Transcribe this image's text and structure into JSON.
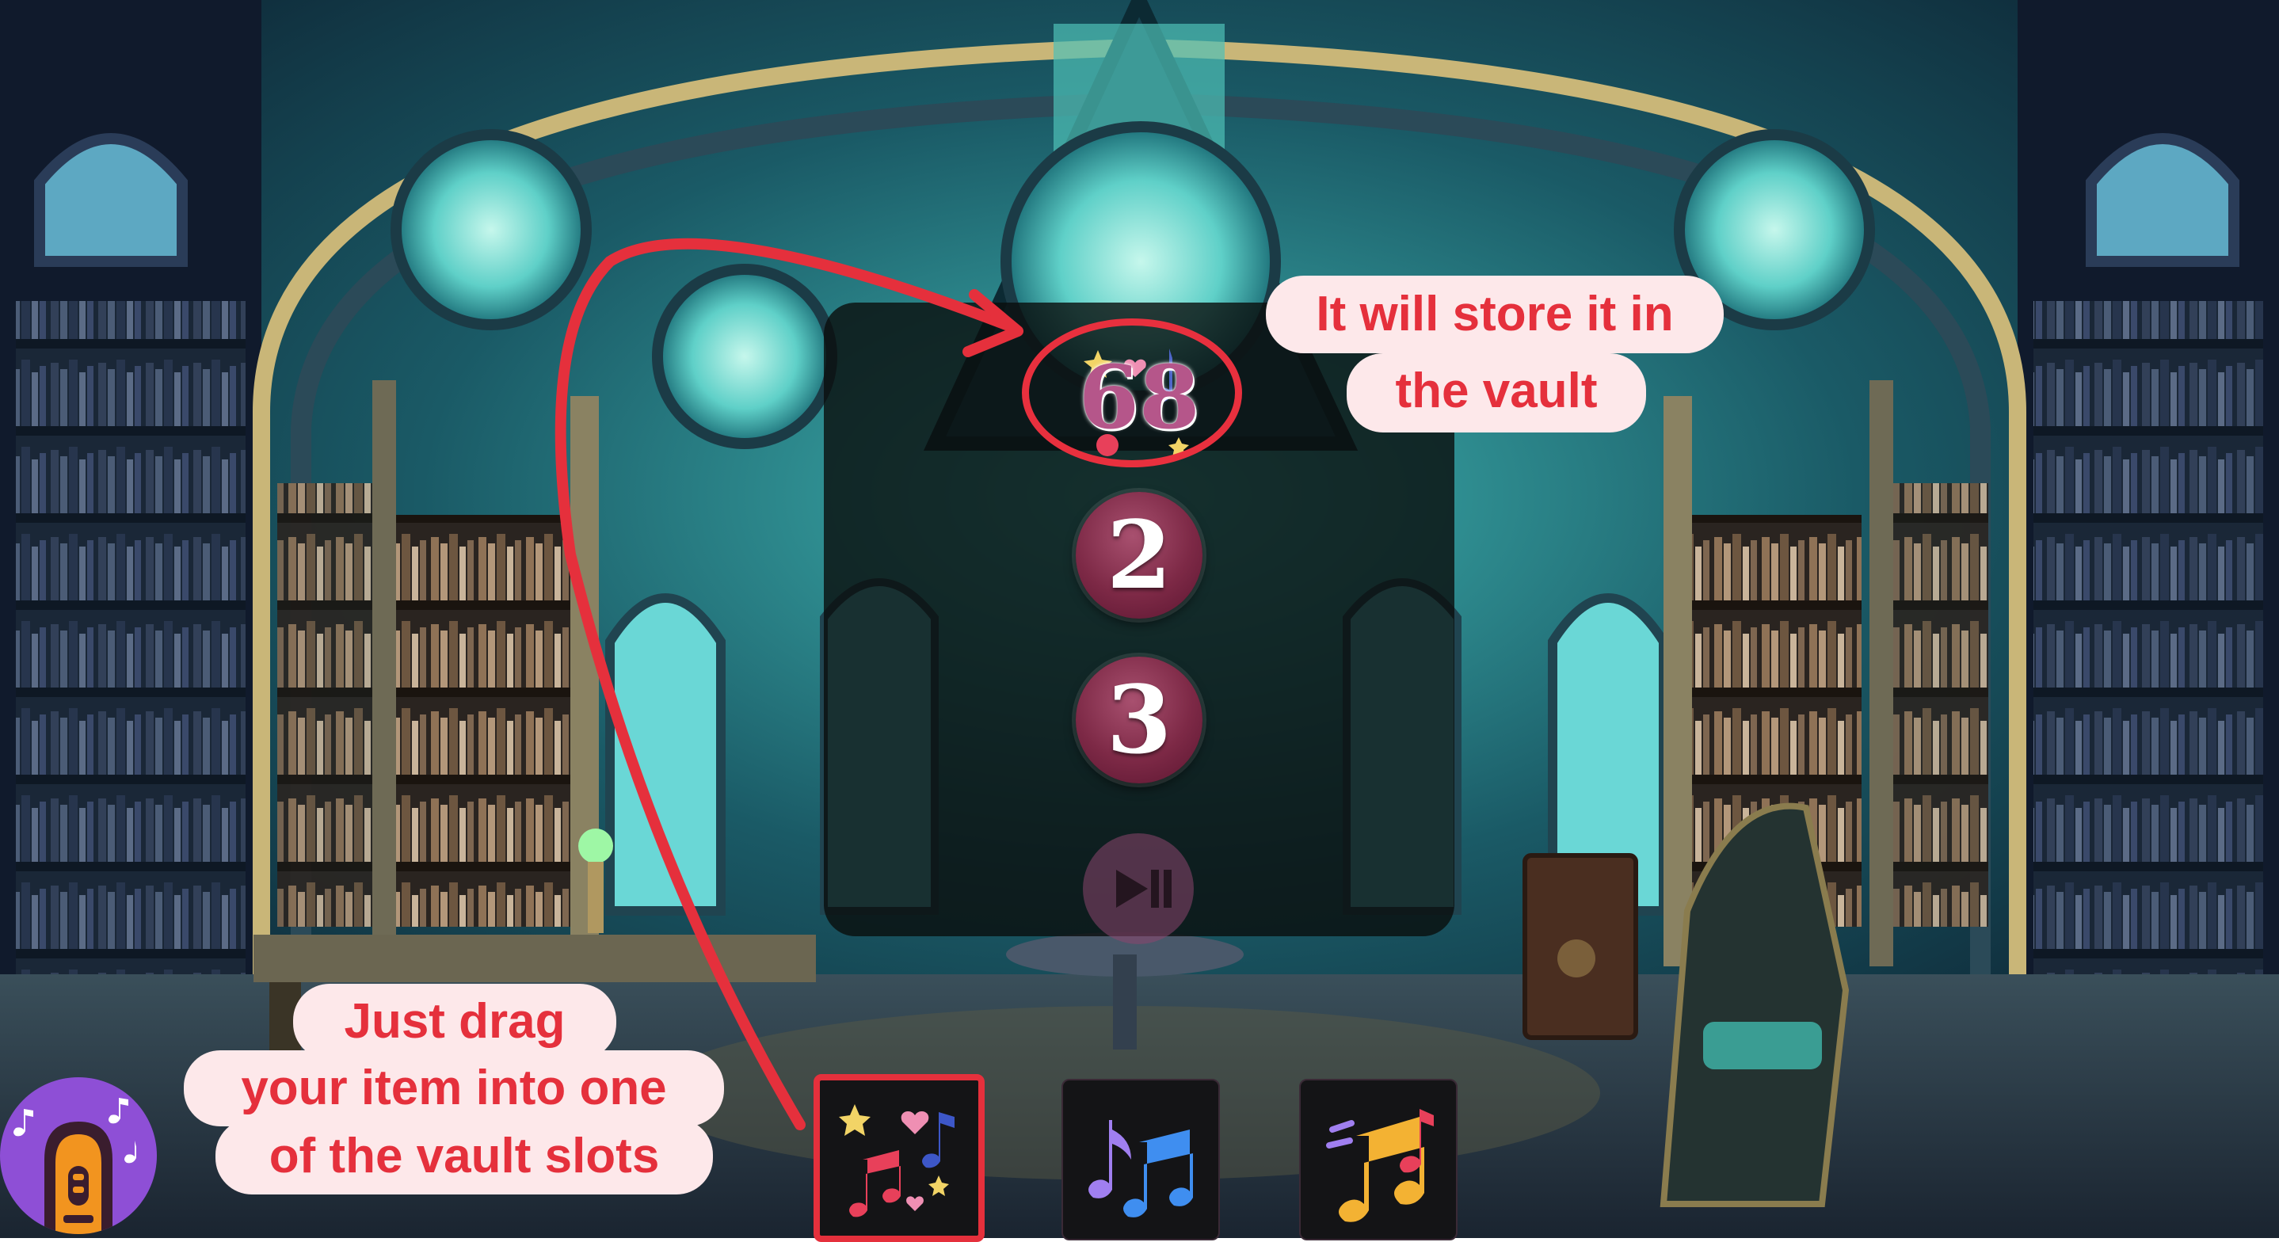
{
  "vault": {
    "slots": [
      {
        "value": "68"
      },
      {
        "value": "2"
      },
      {
        "value": "3"
      }
    ]
  },
  "callouts": {
    "top": {
      "line1": "It will store it in",
      "line2": "the vault"
    },
    "bottom": {
      "line1": "Just drag",
      "line2": "your item into one",
      "line3": "of the vault slots"
    }
  },
  "inventory": {
    "items": [
      {
        "icon": "sparkly-music-notes-icon",
        "selected": true
      },
      {
        "icon": "blue-purple-music-notes-icon",
        "selected": false
      },
      {
        "icon": "flying-music-note-icon",
        "selected": false
      }
    ]
  },
  "icons": {
    "play_pause": "play-pause-icon",
    "jukebox": "jukebox-icon"
  },
  "colors": {
    "highlight": "#e5303c",
    "callout_bg": "#fde8ea",
    "slot_fill": "#7d2946",
    "jukebox_bg": "#8e4fd6"
  }
}
